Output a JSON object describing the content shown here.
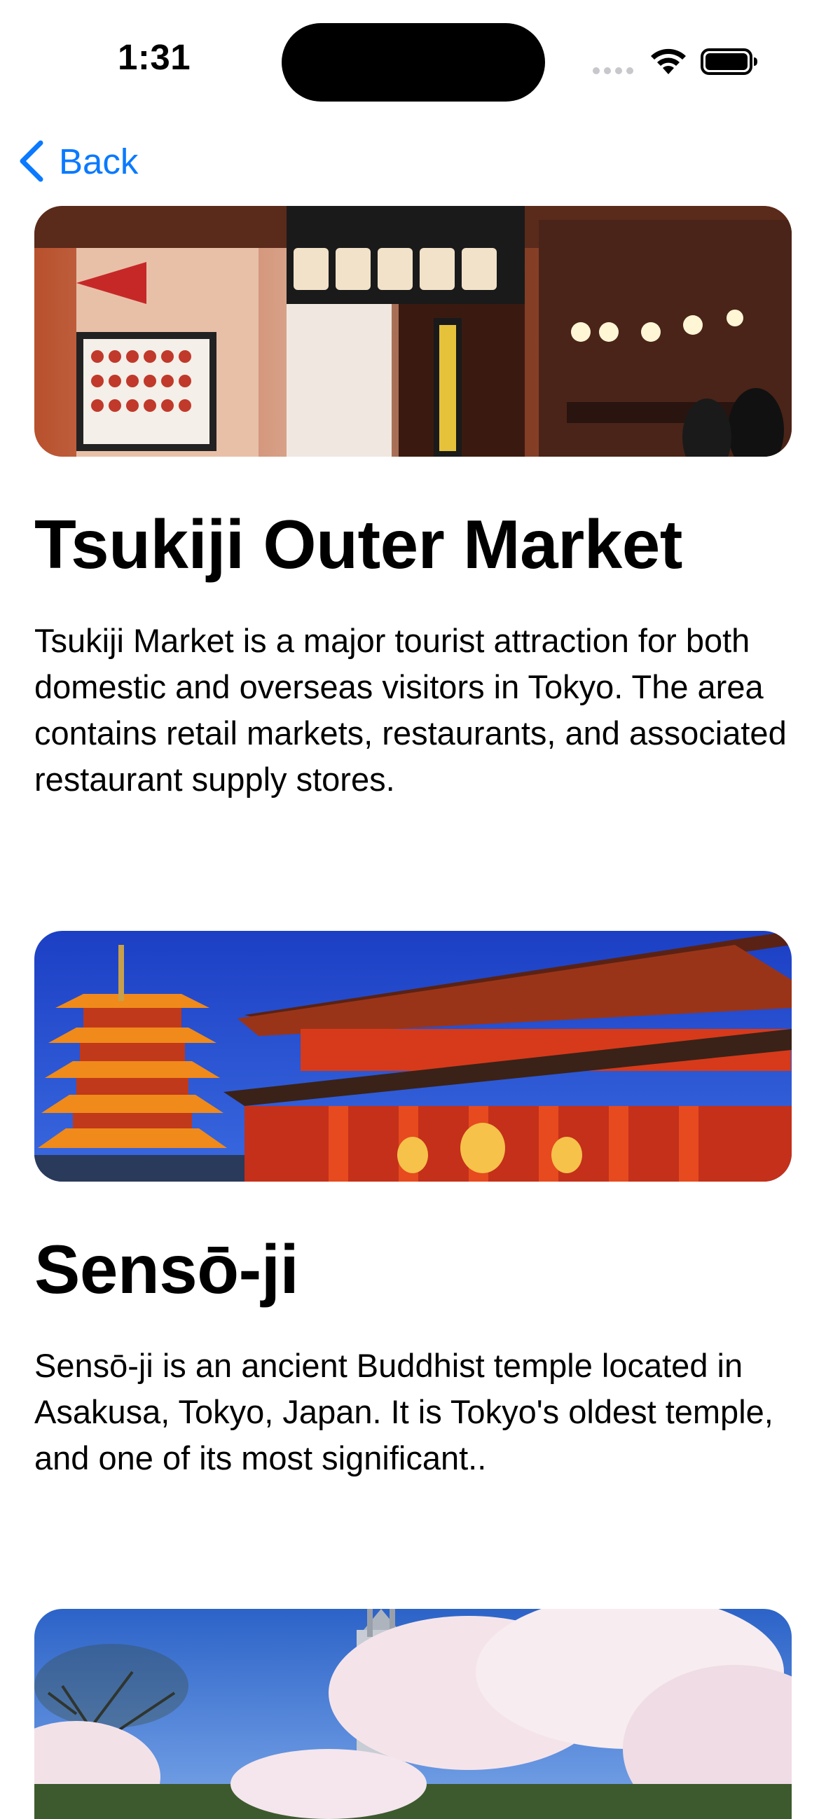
{
  "status_bar": {
    "time": "1:31"
  },
  "nav": {
    "back_label": "Back",
    "back_icon": "chevron-left-icon"
  },
  "colors": {
    "accent": "#0a7aff",
    "background": "#ffffff",
    "text": "#000000"
  },
  "places": [
    {
      "title": "Tsukiji Outer Market",
      "description": "Tsukiji Market is a major tourist attraction for both domestic and overseas visitors in Tokyo. The area contains retail markets, restaurants, and associated restaurant supply stores."
    },
    {
      "title": "Sensō-ji",
      "description": "Sensō-ji is an ancient Buddhist temple located in Asakusa, Tokyo, Japan. It is Tokyo's oldest temple, and one of its most significant.."
    },
    {
      "title": "",
      "description": ""
    }
  ]
}
